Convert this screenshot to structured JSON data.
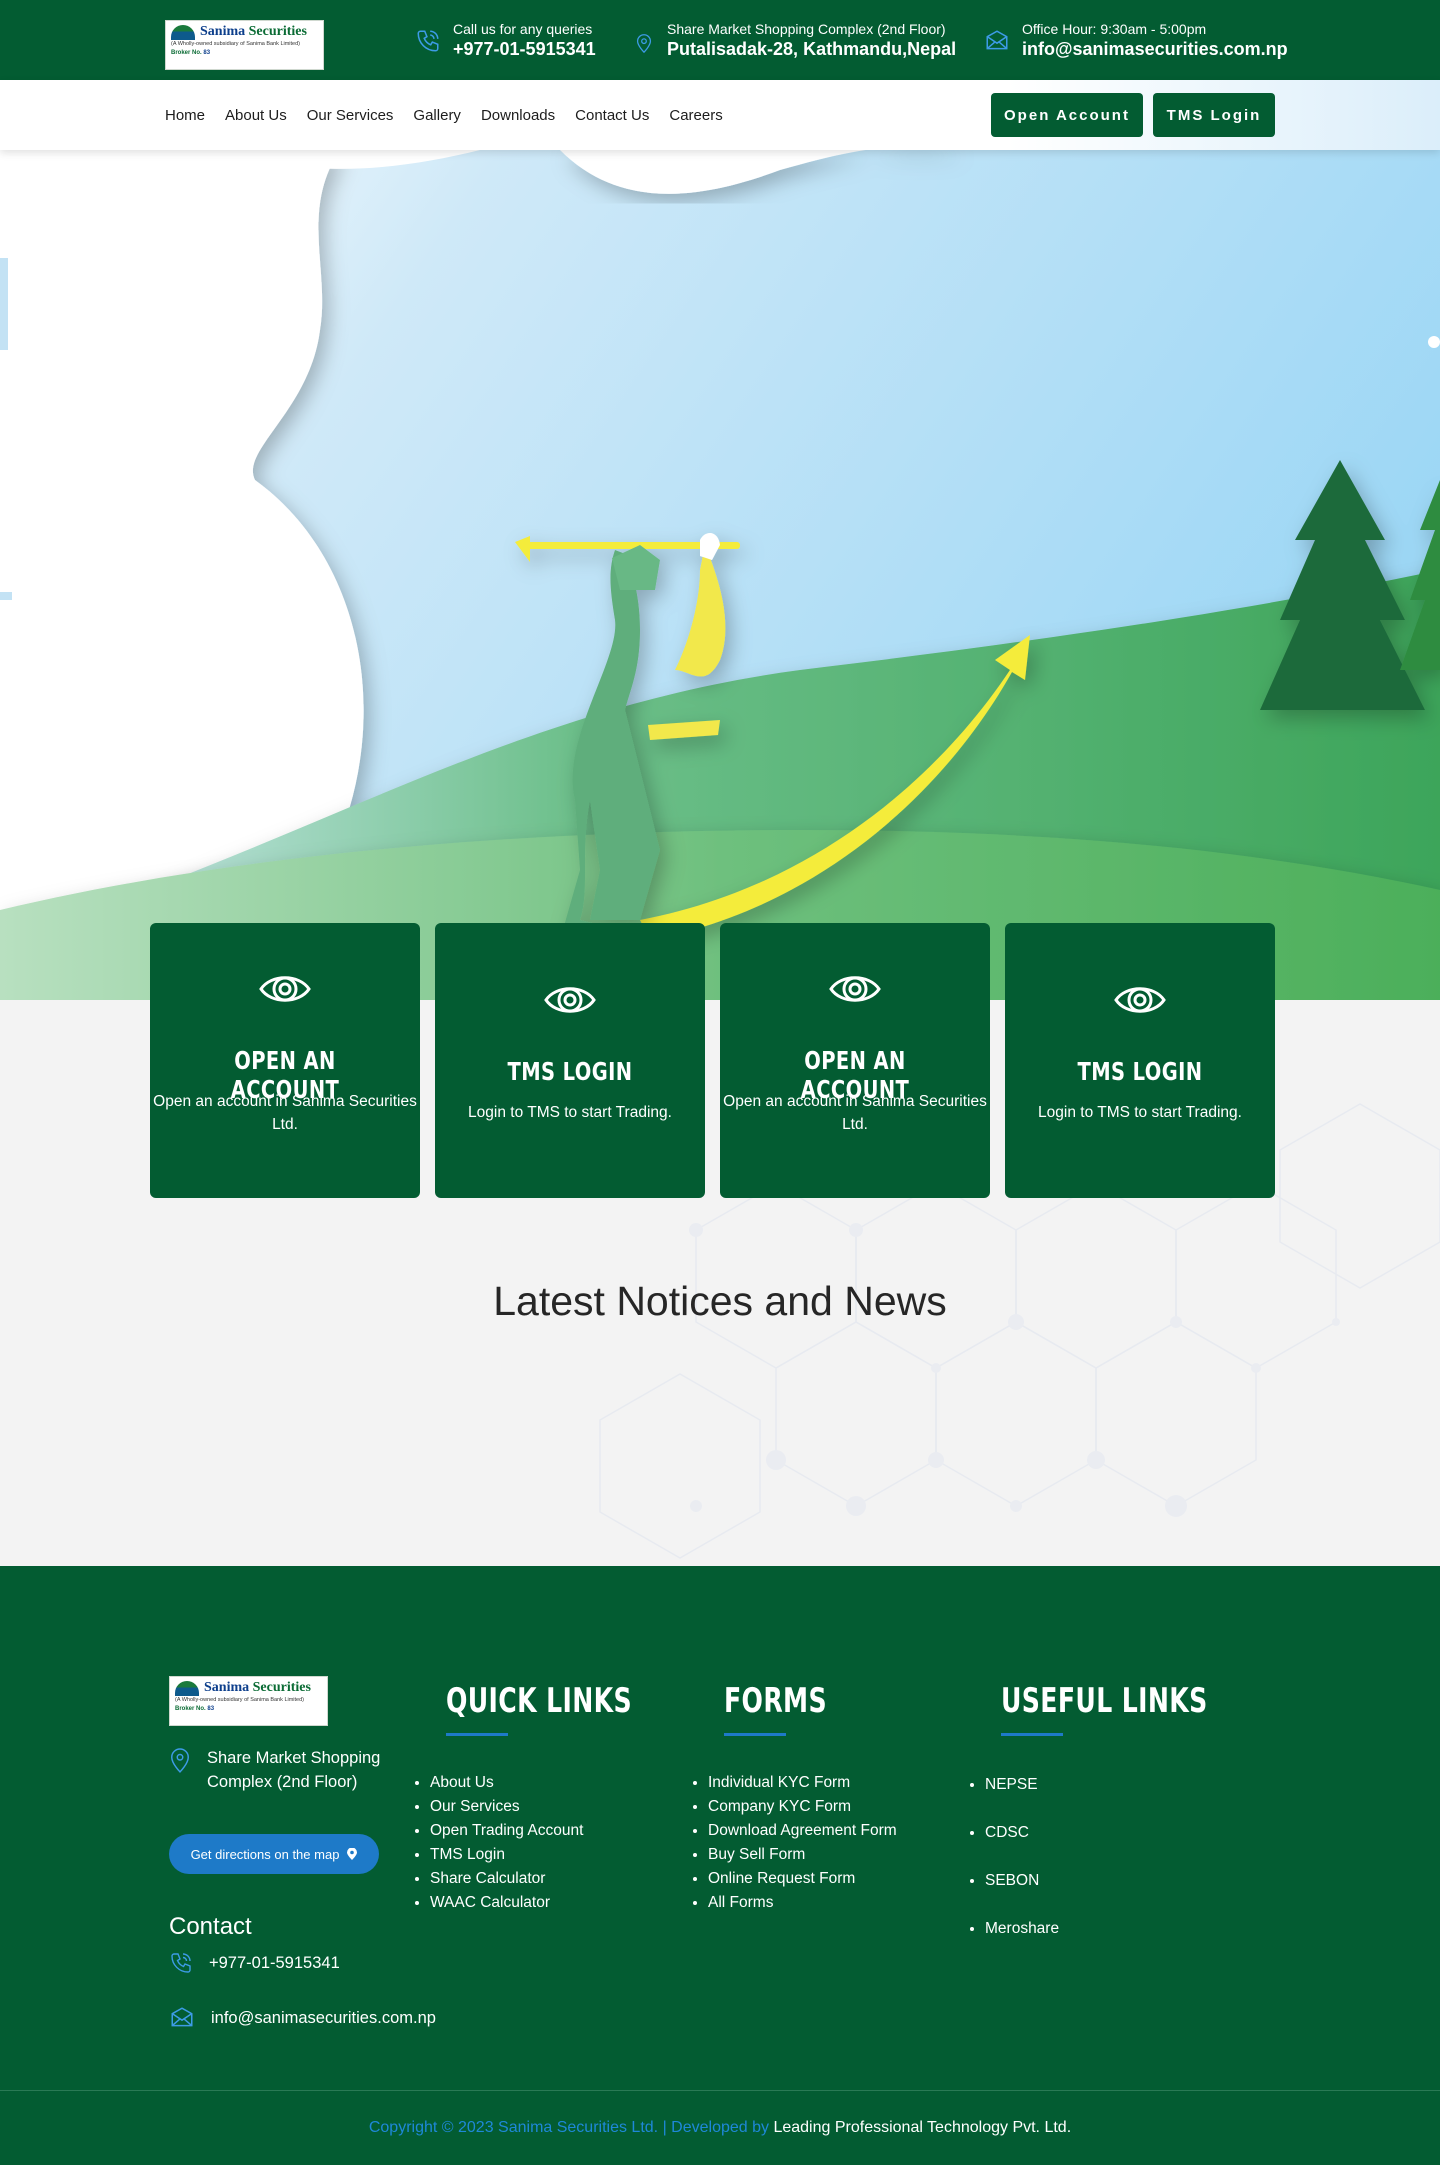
{
  "header": {
    "logo": {
      "name_part1": "Sanima ",
      "name_part2": "Securities",
      "tagline": "(A Wholly-owned subsidiary of Sanima Bank Limited)",
      "broker_label": "Broker No.",
      "broker_no": "83"
    },
    "phone": {
      "label": "Call us for any queries",
      "value": "+977-01-5915341"
    },
    "address": {
      "label": "Share Market Shopping Complex (2nd Floor)",
      "value": "Putalisadak-28, Kathmandu,Nepal"
    },
    "hours": {
      "label": "Office Hour: 9:30am - 5:00pm",
      "value": "info@sanimasecurities.com.np"
    }
  },
  "nav": {
    "links": [
      "Home",
      "About Us",
      "Our Services",
      "Gallery",
      "Downloads",
      "Contact Us",
      "Careers"
    ],
    "open_account": "Open Account",
    "tms_login": "TMS Login"
  },
  "cards": [
    {
      "title": "OPEN AN ACCOUNT",
      "desc": "Open an account in Sanima Securities Ltd."
    },
    {
      "title": "TMS LOGIN",
      "desc": "Login to TMS to start Trading."
    },
    {
      "title": "OPEN AN ACCOUNT",
      "desc": "Open an account in Sanima Securities Ltd."
    },
    {
      "title": "TMS LOGIN",
      "desc": "Login to TMS to start Trading."
    }
  ],
  "news": {
    "title": "Latest Notices and News"
  },
  "footer": {
    "address": "Share Market Shopping Complex (2nd Floor)",
    "directions_button": "Get directions on the map",
    "contact_heading": "Contact",
    "phone": "+977-01-5915341",
    "email": "info@sanimasecurities.com.np",
    "quick_links": {
      "heading": "QUICK LINKS",
      "items": [
        "About Us",
        "Our Services",
        "Open Trading Account",
        "TMS Login",
        "Share Calculator",
        "WAAC Calculator"
      ]
    },
    "forms": {
      "heading": "FORMS",
      "items": [
        "Individual KYC Form",
        "Company KYC Form",
        "Download Agreement Form",
        "Buy Sell Form",
        "Online Request Form",
        "All Forms"
      ]
    },
    "useful_links": {
      "heading": "USEFUL LINKS",
      "items": [
        "NEPSE",
        "CDSC",
        "SEBON",
        "Meroshare"
      ]
    },
    "copyright": "Copyright © 2023 Sanima Securities Ltd. | Developed by ",
    "developer": "Leading Professional Technology Pvt. Ltd."
  },
  "colors": {
    "primary_green": "#035c32",
    "accent_blue": "#1e7ac8",
    "page_bg": "#f3f3f3"
  },
  "icons": [
    "phone-icon",
    "location-icon",
    "mail-icon",
    "eye-icon",
    "map-pin-icon"
  ]
}
